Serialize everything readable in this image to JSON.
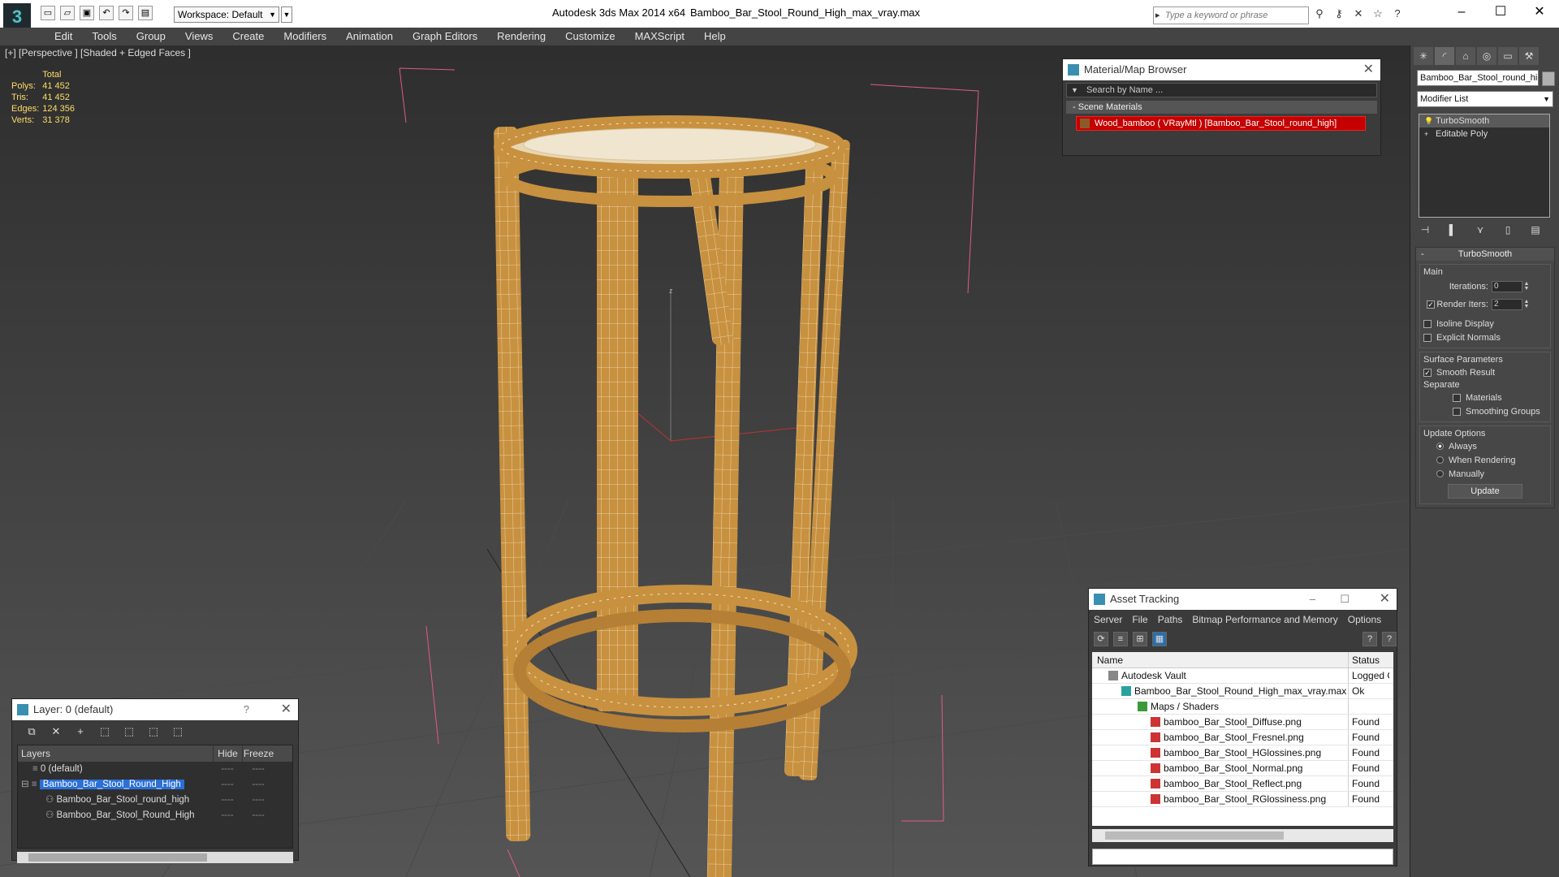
{
  "window": {
    "app_title": "Autodesk 3ds Max  2014 x64",
    "file_title": "Bamboo_Bar_Stool_Round_High_max_vray.max",
    "workspace": "Workspace: Default",
    "search_placeholder": "Type a keyword or phrase"
  },
  "menu": [
    "Edit",
    "Tools",
    "Group",
    "Views",
    "Create",
    "Modifiers",
    "Animation",
    "Graph Editors",
    "Rendering",
    "Customize",
    "MAXScript",
    "Help"
  ],
  "viewport": {
    "label": "[+] [Perspective ] [Shaded + Edged Faces ]",
    "stats": {
      "header": "Total",
      "rows": [
        {
          "label": "Polys:",
          "value": "41 452"
        },
        {
          "label": "Tris:",
          "value": "41 452"
        },
        {
          "label": "Edges:",
          "value": "124 356"
        },
        {
          "label": "Verts:",
          "value": "31 378"
        }
      ]
    },
    "axis_label": "z"
  },
  "material_browser": {
    "title": "Material/Map Browser",
    "search": "Search by Name ...",
    "section": "Scene Materials",
    "item": "Wood_bamboo ( VRayMtl ) [Bamboo_Bar_Stool_round_high]"
  },
  "asset_tracking": {
    "title": "Asset Tracking",
    "menu": [
      "Server",
      "File",
      "Paths",
      "Bitmap Performance and Memory",
      "Options"
    ],
    "columns": {
      "name": "Name",
      "status": "Status"
    },
    "rows": [
      {
        "name": "Autodesk Vault",
        "status": "Logged O"
      },
      {
        "name": "Bamboo_Bar_Stool_Round_High_max_vray.max",
        "status": "Ok"
      },
      {
        "name": "Maps / Shaders",
        "status": ""
      },
      {
        "name": "bamboo_Bar_Stool_Diffuse.png",
        "status": "Found"
      },
      {
        "name": "bamboo_Bar_Stool_Fresnel.png",
        "status": "Found"
      },
      {
        "name": "bamboo_Bar_Stool_HGlossines.png",
        "status": "Found"
      },
      {
        "name": "bamboo_Bar_Stool_Normal.png",
        "status": "Found"
      },
      {
        "name": "bamboo_Bar_Stool_Reflect.png",
        "status": "Found"
      },
      {
        "name": "bamboo_Bar_Stool_RGlossiness.png",
        "status": "Found"
      }
    ]
  },
  "layers": {
    "title": "Layer: 0 (default)",
    "help": "?",
    "columns": {
      "layers": "Layers",
      "hide": "Hide",
      "freeze": "Freeze"
    },
    "rows": [
      {
        "name": "0 (default)",
        "hide": "----",
        "freeze": "----"
      },
      {
        "name": "Bamboo_Bar_Stool_Round_High",
        "hide": "----",
        "freeze": "----"
      },
      {
        "name": "Bamboo_Bar_Stool_round_high",
        "hide": "----",
        "freeze": "----"
      },
      {
        "name": "Bamboo_Bar_Stool_Round_High",
        "hide": "----",
        "freeze": "----"
      }
    ]
  },
  "command_panel": {
    "object_name": "Bamboo_Bar_Stool_round_hig",
    "modifier_list": "Modifier List",
    "stack": [
      "TurboSmooth",
      "Editable Poly"
    ],
    "turbosmooth": {
      "title": "TurboSmooth",
      "main": "Main",
      "iterations_label": "Iterations:",
      "iterations": "0",
      "render_iters_label": "Render Iters:",
      "render_iters": "2",
      "isoline": "Isoline Display",
      "explicit_normals": "Explicit Normals",
      "surface_params": "Surface Parameters",
      "smooth_result": "Smooth Result",
      "separate": "Separate",
      "materials": "Materials",
      "smoothing_groups": "Smoothing Groups",
      "update_options": "Update Options",
      "always": "Always",
      "when_rendering": "When Rendering",
      "manually": "Manually",
      "update_btn": "Update"
    }
  },
  "colors": {
    "bamboo": "#c8913f",
    "bamboo_dark": "#7a4f1c",
    "selection": "#2b6fd8",
    "material_red": "#c40000"
  }
}
